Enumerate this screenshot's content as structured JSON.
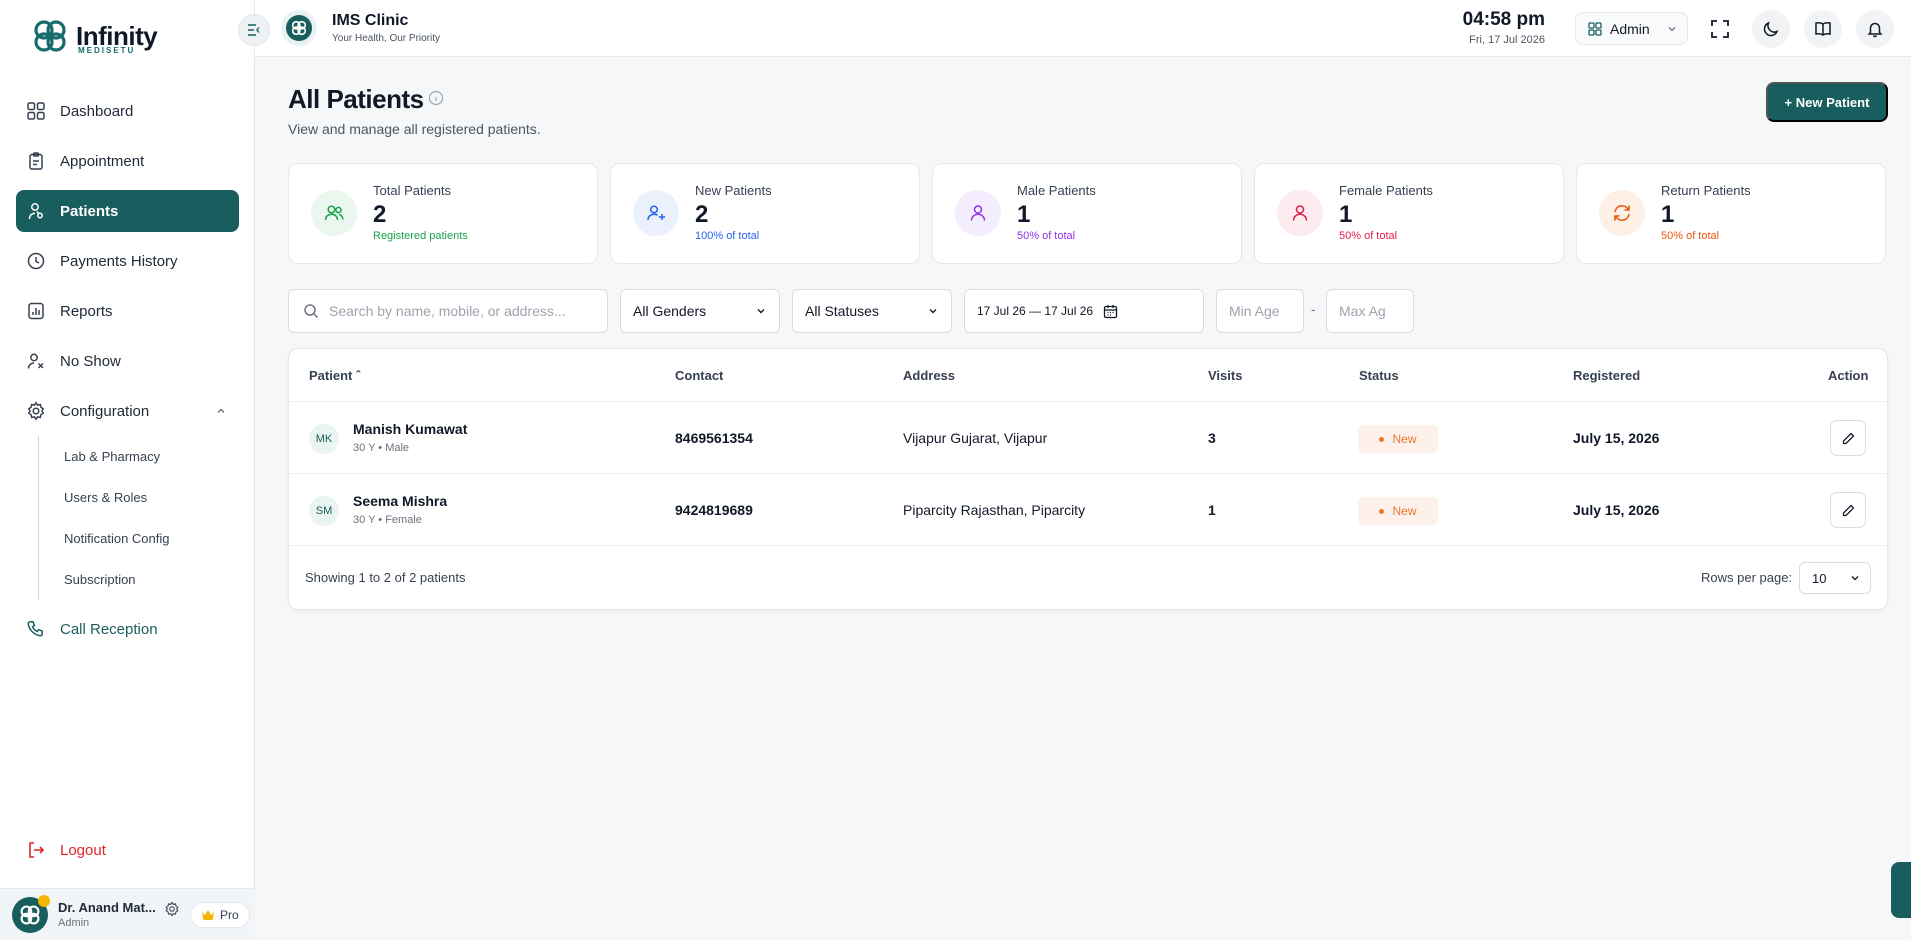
{
  "brand": {
    "name": "Infinity",
    "sub": "MEDISETU"
  },
  "sidebar": {
    "items": [
      {
        "label": "Dashboard"
      },
      {
        "label": "Appointment"
      },
      {
        "label": "Patients"
      },
      {
        "label": "Payments History"
      },
      {
        "label": "Reports"
      },
      {
        "label": "No Show"
      },
      {
        "label": "Configuration"
      }
    ],
    "config_sub": [
      {
        "label": "Lab & Pharmacy"
      },
      {
        "label": "Users & Roles"
      },
      {
        "label": "Notification Config"
      },
      {
        "label": "Subscription"
      }
    ],
    "call_reception": "Call Reception",
    "logout": "Logout",
    "user": {
      "name": "Dr. Anand Mat...",
      "role": "Admin",
      "plan": "Pro"
    }
  },
  "header": {
    "clinic_name": "IMS Clinic",
    "clinic_tagline": "Your Health, Our Priority",
    "time": "04:58 pm",
    "date": "Fri, 17 Jul 2026",
    "role_switch": "Admin"
  },
  "page": {
    "title": "All Patients",
    "subtitle": "View and manage all registered patients.",
    "new_button": "+ New Patient"
  },
  "stats": [
    {
      "label": "Total Patients",
      "value": "2",
      "note": "Registered patients",
      "color": "#16a34a",
      "bg": "#eaf6ee"
    },
    {
      "label": "New Patients",
      "value": "2",
      "note": "100% of total",
      "color": "#2563eb",
      "bg": "#eaf1fd"
    },
    {
      "label": "Male Patients",
      "value": "1",
      "note": "50% of total",
      "color": "#9333ea",
      "bg": "#f4edfd"
    },
    {
      "label": "Female Patients",
      "value": "1",
      "note": "50% of total",
      "color": "#e11d48",
      "bg": "#fdebef"
    },
    {
      "label": "Return Patients",
      "value": "1",
      "note": "50% of total",
      "color": "#ea580c",
      "bg": "#fdf0e7"
    }
  ],
  "filters": {
    "search_placeholder": "Search by name, mobile, or address...",
    "gender": "All Genders",
    "status": "All Statuses",
    "date_range": "17 Jul 26 — 17 Jul 26",
    "min_age_placeholder": "Min Age",
    "max_age_placeholder": "Max Ag",
    "range_sep": "-"
  },
  "table": {
    "columns": [
      "Patient ˆ",
      "Contact",
      "Address",
      "Visits",
      "Status",
      "Registered",
      "Action"
    ],
    "rows": [
      {
        "initials": "MK",
        "name": "Manish Kumawat",
        "meta": "30 Y • Male",
        "contact": "8469561354",
        "address": "Vijapur Gujarat, Vijapur",
        "visits": "3",
        "status": "New",
        "registered": "July 15, 2026"
      },
      {
        "initials": "SM",
        "name": "Seema Mishra",
        "meta": "30 Y • Female",
        "contact": "9424819689",
        "address": "Piparcity Rajasthan, Piparcity",
        "visits": "1",
        "status": "New",
        "registered": "July 15, 2026"
      }
    ],
    "showing": "Showing 1 to 2 of 2 patients",
    "rows_per_page_label": "Rows per page:",
    "rows_per_page": "10"
  },
  "colors": {
    "accent": "#195e5f",
    "danger": "#dc2626",
    "badge_new": "#e8772e"
  }
}
